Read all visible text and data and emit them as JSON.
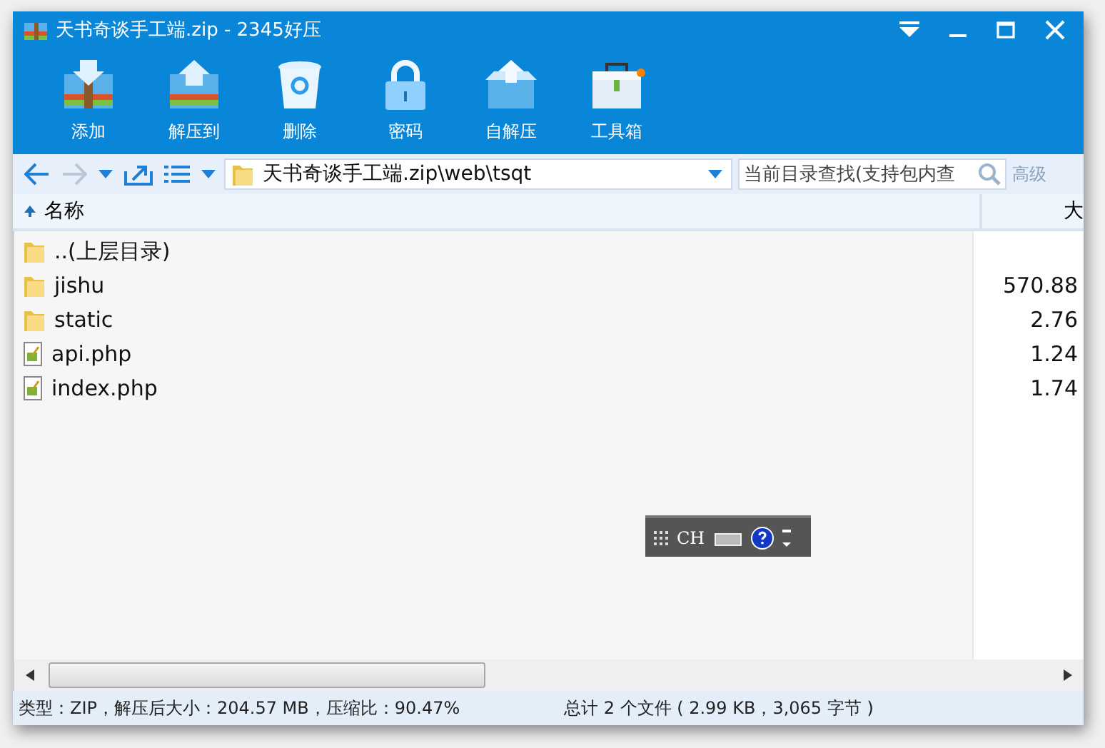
{
  "window": {
    "title": "天书奇谈手工端.zip - 2345好压"
  },
  "toolbar": [
    {
      "kind": "add",
      "label": "添加"
    },
    {
      "kind": "extract",
      "label": "解压到"
    },
    {
      "kind": "delete",
      "label": "删除"
    },
    {
      "kind": "password",
      "label": "密码"
    },
    {
      "kind": "sfx",
      "label": "自解压"
    },
    {
      "kind": "toolbox",
      "label": "工具箱"
    }
  ],
  "address": {
    "path": "天书奇谈手工端.zip\\web\\tsqt"
  },
  "search": {
    "placeholder": "当前目录查找(支持包内查",
    "advanced": "高级"
  },
  "table": {
    "columns": [
      {
        "label": "名称"
      },
      {
        "label": "大"
      }
    ],
    "rows": [
      {
        "kind": "folder",
        "name": "..(上层目录)",
        "size": ""
      },
      {
        "kind": "folder",
        "name": "jishu",
        "size": "570.88"
      },
      {
        "kind": "folder",
        "name": "static",
        "size": "2.76"
      },
      {
        "kind": "file",
        "name": "api.php",
        "size": "1.24"
      },
      {
        "kind": "file",
        "name": "index.php",
        "size": "1.74"
      }
    ]
  },
  "language_bar": {
    "label": "CH"
  },
  "status_bar": {
    "left": "类型：ZIP，解压后大小：204.57 MB，压缩比：90.47%",
    "right": "总计 2 个文件 ( 2.99 KB，3,065 字节 )"
  }
}
